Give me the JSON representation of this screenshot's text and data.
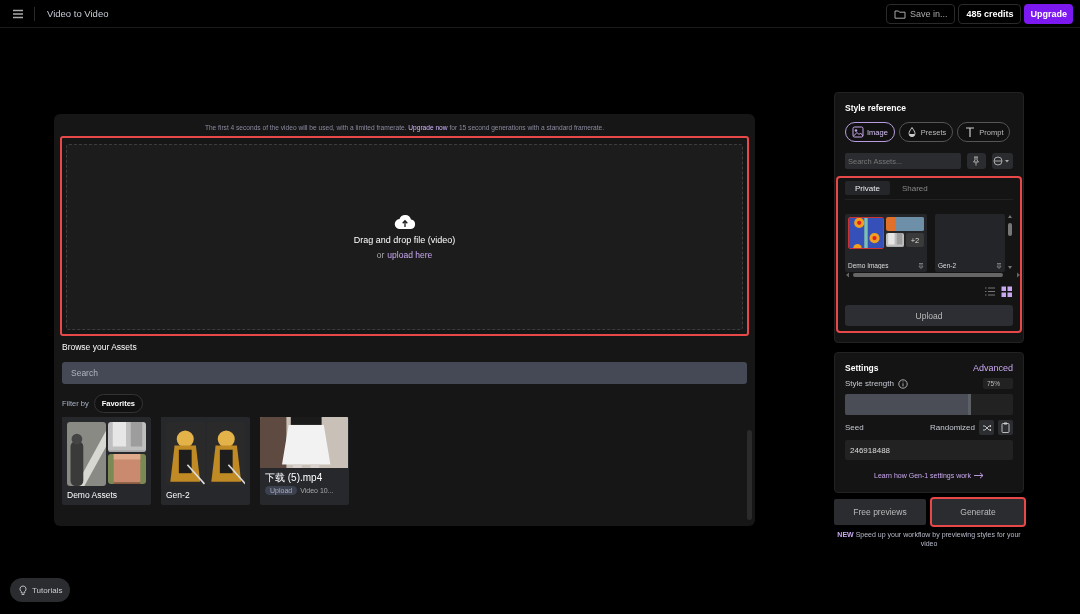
{
  "top_bar": {
    "title": "Video to Video",
    "save_button": "Save in...",
    "credits": "485 credits",
    "upgrade_button": "Upgrade"
  },
  "upload_area": {
    "notice": "The first 4 seconds of the video will be used, with a limited framerate. **Upgrade now** for 15 second generations with a standard framerate.",
    "prompt": "Drag and drop file (video)",
    "alt_prefix": "or",
    "alt_link": "upload here",
    "highlighted": true
  },
  "assets": {
    "title": "Browse your Assets",
    "search": {
      "placeholder": "Search"
    },
    "filter_label": "Filter by",
    "filter_chip": "Favorites",
    "items": [
      {
        "kind": "folder",
        "name": "Demo Assets"
      },
      {
        "kind": "folder",
        "name": "Gen-2"
      },
      {
        "kind": "file",
        "name": "下载 (5).mp4",
        "tag": "Upload",
        "meta": "Video 10..."
      }
    ]
  },
  "style_reference": {
    "title": "Style reference",
    "modes": [
      {
        "label": "Image",
        "selected": true
      },
      {
        "label": "Presets",
        "selected": false
      },
      {
        "label": "Prompt",
        "selected": false
      }
    ],
    "search": {
      "placeholder": "Search Assets..."
    },
    "highlighted": true,
    "tabs": [
      {
        "label": "Private",
        "selected": true
      },
      {
        "label": "Shared",
        "selected": false
      }
    ],
    "folders": [
      {
        "name": "Demo Images",
        "more": "+2"
      },
      {
        "name": "Gen-2"
      }
    ],
    "views": [
      {
        "kind": "list",
        "selected": false
      },
      {
        "kind": "grid",
        "selected": true
      }
    ],
    "upload_button": "Upload"
  },
  "settings": {
    "title": "Settings",
    "advanced": "Advanced",
    "strength_label": "Style strength",
    "strength_value": "75%",
    "strength": {
      "level": 0.75
    },
    "seed_label": "Seed",
    "seed_mode": "Randomized",
    "seed_value": "246918488",
    "learn_link": "Learn how Gen-1 settings work"
  },
  "actions": [
    {
      "label": "Free previews",
      "highlighted": false
    },
    {
      "label": "Generate",
      "highlighted": true
    }
  ],
  "tip": {
    "badge": "NEW",
    "text": "Speed up your workflow by previewing styles for your video"
  },
  "tutorials_button": "Tutorials"
}
